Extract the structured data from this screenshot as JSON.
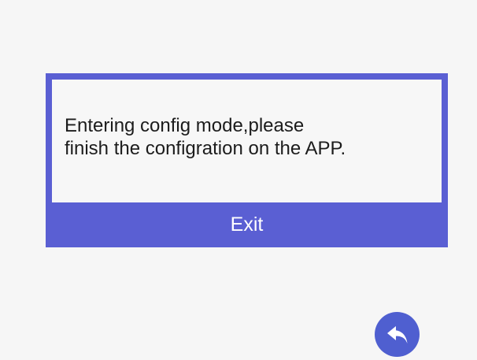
{
  "dialog": {
    "message_line1": "Entering config mode,please",
    "message_line2": "finish the configration on the APP.",
    "exit_label": "Exit"
  },
  "nav": {
    "back_icon": "back-arrow-icon"
  },
  "colors": {
    "accent": "#5a5fd3",
    "background": "#f6f6f6",
    "dialog_body": "#f7f7f7",
    "text": "#1c1c1c"
  }
}
